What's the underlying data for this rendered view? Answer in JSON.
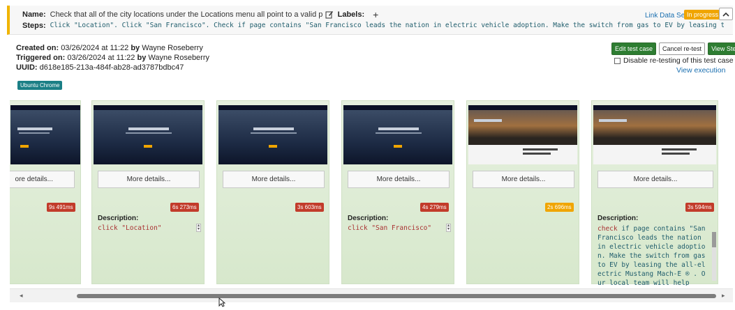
{
  "header": {
    "name_label": "Name:",
    "name_value": "Check that all of the city locations under the Locations menu all point to a valid page witho",
    "labels_label": "Labels:",
    "add_label": "+",
    "steps_label": "Steps:",
    "steps_value": "Click \"Location\". Click \"San Francisco\". Check if page contains \"San Francisco leads the nation in electric vehicle adoption. Make the switch from gas to EV by leasing the all-electric Mu...",
    "link_data_set": "Link Data Set",
    "status_badge": "In progress",
    "status_color": "#f0a500",
    "accent_color": "#f0b400"
  },
  "meta": {
    "created_label": "Created on:",
    "created_value": "03/26/2024 at 11:22",
    "created_by_label": "by",
    "created_by": "Wayne Roseberry",
    "triggered_label": "Triggered on:",
    "triggered_value": "03/26/2024 at 11:22",
    "triggered_by_label": "by",
    "triggered_by": "Wayne Roseberry",
    "uuid_label": "UUID:",
    "uuid_value": "d618e185-213a-484f-ab28-ad3787bdbc47",
    "environment_badge": "Ubuntu Chrome"
  },
  "actions": {
    "edit_test_case": "Edit test case",
    "cancel_retest": "Cancel re-test",
    "view_steps": "View Steps",
    "disable_retesting": "Disable re-testing of this test case",
    "view_execution": "View execution"
  },
  "cards": [
    {
      "more_label": "ore details...",
      "time": "9s 491ms",
      "time_color": "red"
    },
    {
      "more_label": "More details...",
      "time": "6s 273ms",
      "time_color": "red",
      "desc_label": "Description:",
      "desc_code": "click \"Location\""
    },
    {
      "more_label": "More details...",
      "time": "3s 603ms",
      "time_color": "red"
    },
    {
      "more_label": "More details...",
      "time": "4s 279ms",
      "time_color": "red",
      "desc_label": "Description:",
      "desc_code": "click \"San Francisco\""
    },
    {
      "more_label": "More details...",
      "time": "2s 696ms",
      "time_color": "orange"
    },
    {
      "more_label": "More details...",
      "time": "3s 594ms",
      "time_color": "red",
      "desc_label": "Description:",
      "desc_long_kw": "check",
      "desc_long_rest": " if page contains \"San Francisco leads the nation in electric vehicle adoption. Make the switch from gas to EV by leasing the all-electric Mustang Mach-E ® . Our local team will help"
    }
  ],
  "icons": {
    "edit": "edit-icon",
    "collapse": "chevron-up-icon",
    "scroll_left": "arrow-left-icon",
    "scroll_right": "arrow-right-icon"
  }
}
